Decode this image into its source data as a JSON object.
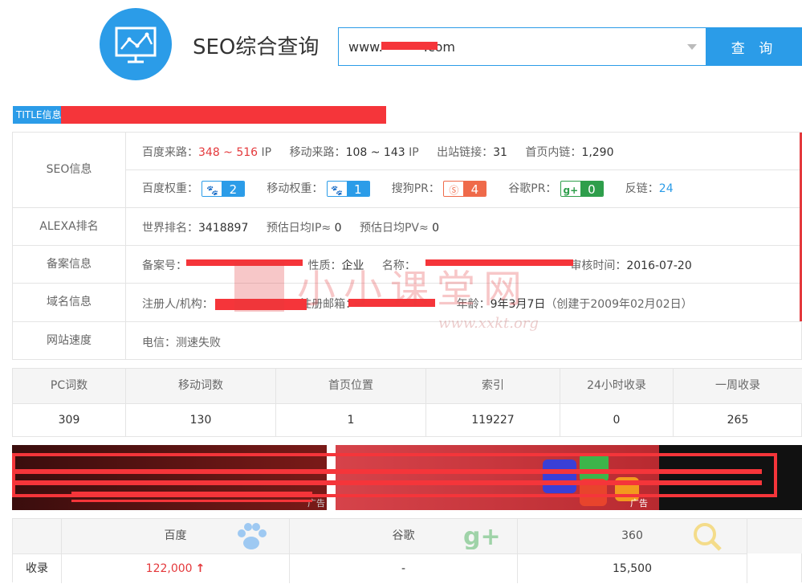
{
  "header": {
    "title": "SEO综合查询",
    "search_value": "www.          .com",
    "search_button": "查 询",
    "logo_icon": "monitor-chart-icon",
    "accent_color": "#2b9ce8"
  },
  "title_info": {
    "label": "TITLE信息"
  },
  "seo_info": {
    "label": "SEO信息",
    "baidu_traffic_label": "百度来路：",
    "baidu_traffic_value": "348 ~ 516",
    "baidu_traffic_unit": "IP",
    "mobile_traffic_label": "移动来路：",
    "mobile_traffic_value": "108 ~ 143",
    "mobile_traffic_unit": "IP",
    "outbound_label": "出站链接：",
    "outbound_value": "31",
    "internal_label": "首页内链：",
    "internal_value": "1,290",
    "baidu_weight_label": "百度权重：",
    "baidu_weight_value": "2",
    "mobile_weight_label": "移动权重：",
    "mobile_weight_value": "1",
    "sogou_pr_label": "搜狗PR：",
    "sogou_pr_value": "4",
    "google_pr_label": "谷歌PR：",
    "google_pr_value": "0",
    "backlinks_label": "反链：",
    "backlinks_value": "24"
  },
  "alexa": {
    "label": "ALEXA排名",
    "world_label": "世界排名：",
    "world_value": "3418897",
    "ip_label": "预估日均IP≈",
    "ip_value": "0",
    "pv_label": "预估日均PV≈",
    "pv_value": "0"
  },
  "icp": {
    "label": "备案信息",
    "number_label": "备案号：",
    "nature_label": "性质：",
    "nature_value": "企业",
    "name_label": "名称：",
    "audit_label": "审核时间：",
    "audit_value": "2016-07-20"
  },
  "domain": {
    "label": "域名信息",
    "registrant_label": "注册人/机构：",
    "email_label": "注册邮箱：",
    "age_label": "年龄：",
    "age_value": "9年3月7日",
    "created_value": "（创建于2009年02月02日）"
  },
  "speed": {
    "label": "网站速度",
    "value": "电信：测速失败"
  },
  "watermark": {
    "text": "小小课堂网",
    "url": "www.xxkt.org"
  },
  "stats": {
    "headers": [
      "PC词数",
      "移动词数",
      "首页位置",
      "索引",
      "24小时收录",
      "一周收录"
    ],
    "values": [
      "309",
      "130",
      "1",
      "119227",
      "0",
      "265"
    ]
  },
  "ad": {
    "label": "广告"
  },
  "engines": {
    "headers": [
      "百度",
      "谷歌",
      "360"
    ],
    "row_label": "收录",
    "values": [
      "122,000",
      "-",
      "15,500"
    ],
    "trend_symbol": "↑"
  }
}
